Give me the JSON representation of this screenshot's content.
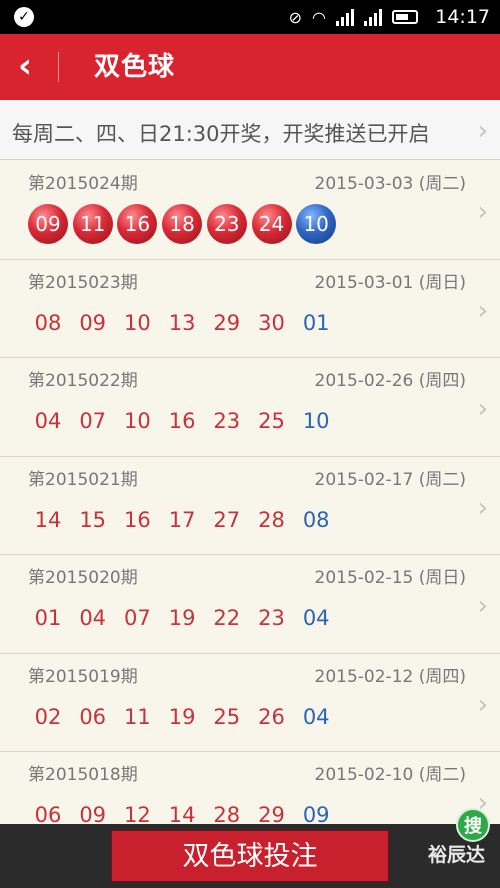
{
  "status_bar": {
    "time": "14:17"
  },
  "header": {
    "title": "双色球",
    "back_icon": "chevron-left-icon"
  },
  "notice": {
    "text": "每周二、四、日21:30开奖，开奖推送已开启"
  },
  "draws": [
    {
      "issue": "第2015024期",
      "date": "2015-03-03 (周二)",
      "red": [
        "09",
        "11",
        "16",
        "18",
        "23",
        "24"
      ],
      "blue": "10",
      "highlight": true
    },
    {
      "issue": "第2015023期",
      "date": "2015-03-01 (周日)",
      "red": [
        "08",
        "09",
        "10",
        "13",
        "29",
        "30"
      ],
      "blue": "01"
    },
    {
      "issue": "第2015022期",
      "date": "2015-02-26 (周四)",
      "red": [
        "04",
        "07",
        "10",
        "16",
        "23",
        "25"
      ],
      "blue": "10"
    },
    {
      "issue": "第2015021期",
      "date": "2015-02-17 (周二)",
      "red": [
        "14",
        "15",
        "16",
        "17",
        "27",
        "28"
      ],
      "blue": "08"
    },
    {
      "issue": "第2015020期",
      "date": "2015-02-15 (周日)",
      "red": [
        "01",
        "04",
        "07",
        "19",
        "22",
        "23"
      ],
      "blue": "04"
    },
    {
      "issue": "第2015019期",
      "date": "2015-02-12 (周四)",
      "red": [
        "02",
        "06",
        "11",
        "19",
        "25",
        "26"
      ],
      "blue": "04"
    },
    {
      "issue": "第2015018期",
      "date": "2015-02-10 (周二)",
      "red": [
        "06",
        "09",
        "12",
        "14",
        "28",
        "29"
      ],
      "blue": "09"
    }
  ],
  "bottom": {
    "bet_button": "双色球投注"
  },
  "search_badge": "搜",
  "watermark": "裕辰达",
  "colors": {
    "accent_red": "#d9232f",
    "number_red": "#c7323c",
    "number_blue": "#2a65b6",
    "background": "#f8f5ea"
  }
}
